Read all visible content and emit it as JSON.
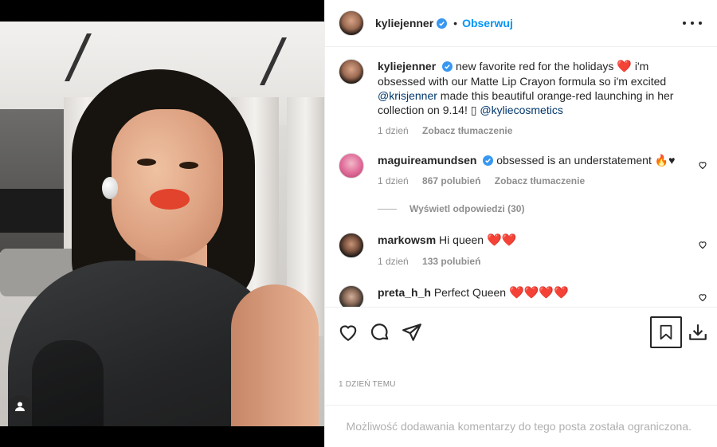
{
  "header": {
    "username": "kyliejenner",
    "separator": "•",
    "follow_label": "Obserwuj"
  },
  "caption": {
    "username": "kyliejenner",
    "text_before_heart": "new favorite red for the holidays",
    "text_after_heart": "i'm obsessed with our Matte Lip Crayon formula so i'm excited",
    "mention_1": "@krisjenner",
    "text_after_mention": "made this beautiful orange-red launching in her collection on 9.14!",
    "placeholder_glyph": "▯",
    "mention_2": "@kyliecosmetics",
    "time": "1 dzień",
    "translate": "Zobacz tłumaczenie"
  },
  "comments": [
    {
      "username": "maguireamundsen",
      "text": "obsessed is an understatement",
      "emoji": "🔥♥",
      "time": "1 dzień",
      "likes": "867 polubień",
      "translate": "Zobacz tłumaczenie"
    },
    {
      "username": "markowsm",
      "text": "Hi queen",
      "emoji": "❤️❤️",
      "time": "1 dzień",
      "likes": "133 polubień"
    },
    {
      "username": "preta_h_h",
      "text": "Perfect Queen",
      "emoji": "❤️❤️❤️❤️"
    }
  ],
  "replies_label": "Wyświetl odpowiedzi (30)",
  "timestamp": "1 DZIEŃ TEMU",
  "comments_restricted": "Możliwość dodawania komentarzy do tego posta została ograniczona.",
  "icons": [
    "heart-icon",
    "comment-icon",
    "share-icon",
    "bookmark-icon",
    "download-icon",
    "more-icon",
    "verified-icon",
    "user-tag-icon"
  ],
  "colors": {
    "link": "#00376b",
    "follow": "#0095f6",
    "muted": "#8e8e8e",
    "heart": "#e8191b"
  }
}
